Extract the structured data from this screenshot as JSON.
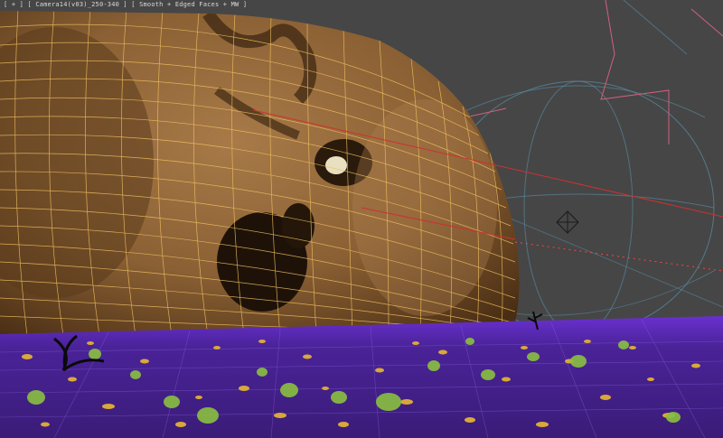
{
  "viewport": {
    "label": "[ + ] [ Camera14(v03)_250-340 ] [ Smooth + Edged Faces + MW ]",
    "background_color": "#464646",
    "icons": {
      "head_mesh": "wireframe-head-mesh-icon",
      "camera_target": "camera-target-icon",
      "ground_grid": "ground-grid-icon"
    }
  },
  "colors": {
    "mesh_fill": "#9a7040",
    "mesh_shadow": "#3a2410",
    "mesh_wire": "#f0c060",
    "ground": "#5a2ab8",
    "ground_grid": "#8a60e0",
    "grass": "#8ac040",
    "rocks": "#d8a83a",
    "light_wire": "#5a90a8",
    "red_lines": "#d03030",
    "pink_lines": "#d06080"
  }
}
